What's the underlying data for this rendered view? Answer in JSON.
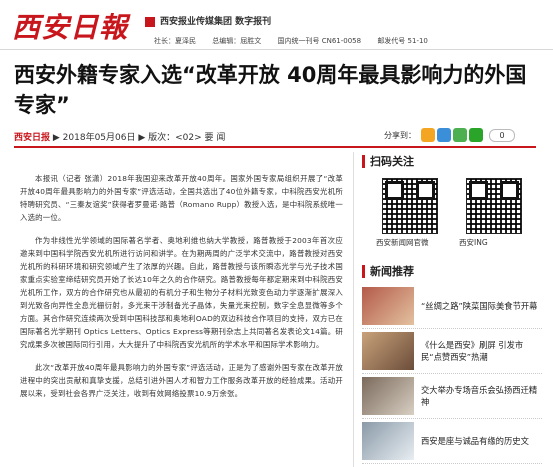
{
  "header": {
    "logo_text": "西安日報",
    "group_text": "西安报业传媒集团  数字报刊",
    "meta": [
      "社长：夏泽民",
      "总编辑：屈胜文",
      "国内统一刊号 CN61-0058",
      "邮发代号 51-10"
    ]
  },
  "article": {
    "title": "西安外籍专家入选“改革开放 40周年最具影响力的外国专家”",
    "source": "西安日报",
    "date_and_page": "▶ 2018年05月06日 ▶ 版次：<02> 要 闻",
    "paragraphs": [
      "本报讯（记者  张潇）2018年我国迎来改革开放40周年。国家外国专家局组织开展了“改革开放40周年最具影响力的外国专家”评选活动，全国共选出了40位外籍专家，中科院西安光机所特聘研究员、“三秦友谊奖”获得者罗曼诺·路普（Romano Rupp）教授入选，是中科院系统唯一入选的一位。",
      "作为非线性光学领域的国际著名学者、奥地利维也纳大学教授，路普教授于2003年首次应邀来到中国科学院西安光机所进行访问和讲学。在为期两周的广泛学术交流中，路普教授对西安光机所的科研环境和研究领域产生了浓厚的兴趣。自此，路普教授与该所瞬态光学与光子技术国家重点实验室缔结研究员开始了长达10年之久的合作研究。路普教授每年都定期来到中科院西安光机所工作，双方的合作研究也从最初的有机分子和生物分子材料光致变色动力学逐渐扩展深入到光致各向异性全息光栅衍射，多光束干涉制备光子晶体，失量光束控制，数字全息显微等多个方面。其合作研究连续两次受到中国科技部和奥地利OAD的双边科技合作项目的支持，双方已在国际著名光学期刊 Optics Letters、Optics Express等期刊杂志上共同著名发表论文14篇。研究成果多次被国际同行引用，大大提升了中科院西安光机所的学术水平和国际学术影响力。",
      "此次“改革开放40周年最具影响力的外国专家”评选活动，正是为了感谢外国专家在改革开放进程中的突出贡献和真挚支援，总结引进外国人才和智力工作服务改革开放的经验成果。活动开展以来，受到社会各界广泛关注，收到有效网络投票10.9万余张。"
    ]
  },
  "share": {
    "label": "分享到：",
    "count": "0",
    "icons": [
      {
        "name": "weibo-share-icon",
        "color": "#f4a623"
      },
      {
        "name": "qzone-share-icon",
        "color": "#3b8fd8"
      },
      {
        "name": "douban-share-icon",
        "color": "#4caf50"
      },
      {
        "name": "wechat-share-icon",
        "color": "#2aa52a"
      }
    ]
  },
  "sidebar": {
    "qr_section_title": "扫码关注",
    "qr_captions": [
      "西安新闻网官微",
      "西安ING"
    ],
    "news_section_title": "新闻推荐",
    "news": [
      {
        "title": "“丝绸之路”陕菜国际美食节开幕",
        "thumb_color": "#b45a4a"
      },
      {
        "title": "《什么是西安》刷屏 引发市民“点赞西安”热潮",
        "thumb_color": "#c9a27a"
      },
      {
        "title": "交大举办专场音乐会弘扬西迁精神",
        "thumb_color": "#7a6a5c"
      },
      {
        "title": "西安是座与诚品有缘的历史文",
        "thumb_color": "#8a9aa8"
      }
    ]
  },
  "colors": {
    "brand_red": "#c8161d"
  }
}
